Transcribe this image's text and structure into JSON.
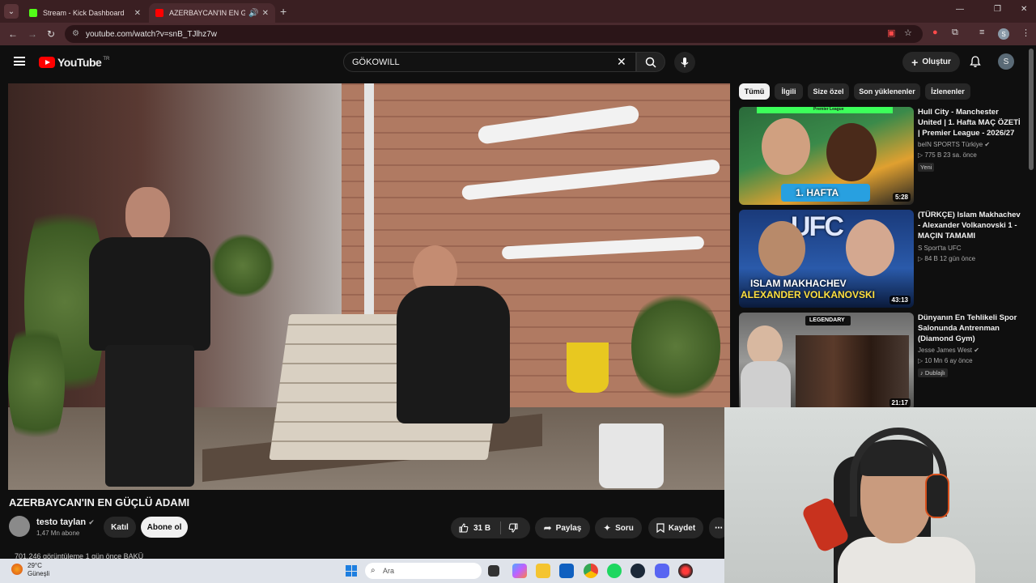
{
  "browser": {
    "tabs": [
      {
        "title": "Stream - Kick Dashboard",
        "favicon_color": "#53fc18"
      },
      {
        "title": "AZERBAYCAN'IN EN GÜÇLÜ",
        "favicon_color": "#ff0000"
      }
    ],
    "url": "youtube.com/watch?v=snB_TJlhz7w"
  },
  "youtube": {
    "logo_text": "YouTube",
    "country_code": "TR",
    "search_value": "GÖKOWILL",
    "create_label": "Oluştur",
    "avatar_letter": "S"
  },
  "video": {
    "title": "AZERBAYCAN'IN EN GÜÇLÜ ADAMI",
    "channel": "testo taylan",
    "subscribers": "1,47 Mn abone",
    "join_label": "Katıl",
    "subscribe_label": "Abone ol",
    "likes": "31 B",
    "share_label": "Paylaş",
    "ask_label": "Soru",
    "save_label": "Kaydet",
    "views_line": "701.246 görüntüleme  1 gün önce  BAKÜ"
  },
  "chips": [
    "Tümü",
    "İlgili",
    "Size özel",
    "Son yüklenenler",
    "İzlenenler"
  ],
  "recommendations": [
    {
      "title": "Hull City - Manchester United | 1. Hafta MAÇ ÖZETİ | Premier League - 2026/27",
      "channel": "beIN SPORTS Türkiye",
      "meta": "775 B  23 sa. önce",
      "badge": "Yeni",
      "duration": "5:28",
      "thumb_caption": "1. HAFTA",
      "thumb_top": "Premier League"
    },
    {
      "title": "(TÜRKÇE) Islam Makhachev - Alexander Volkanovski 1 - MAÇIN TAMAMI",
      "channel": "S Sport'ta UFC",
      "meta": "84 B  12 gün önce",
      "duration": "43:13",
      "thumb_caption_1": "ISLAM MAKHACHEV",
      "thumb_caption_2": "ALEXANDER VOLKANOVSKI",
      "thumb_top": "UFC"
    },
    {
      "title": "Dünyanın En Tehlikeli Spor Salonunda Antrenman (Diamond Gym)",
      "channel": "Jesse James West",
      "meta": "10 Mn  6 ay önce",
      "badge": "Dublajlı",
      "duration": "21:17",
      "thumb_top": "LEGENDARY"
    }
  ],
  "taskbar": {
    "temperature": "29°C",
    "weather": "Güneşli",
    "search_placeholder": "Ara"
  }
}
